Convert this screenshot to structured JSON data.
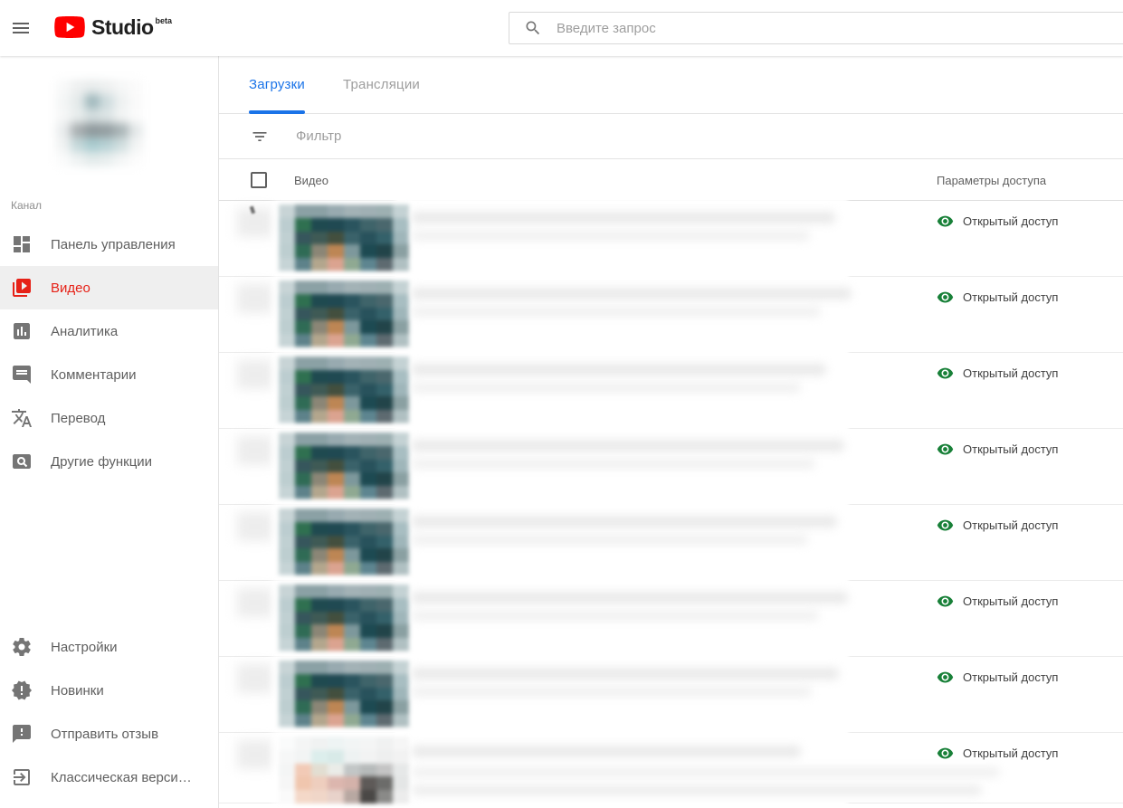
{
  "topbar": {
    "logo_text": "Studio",
    "logo_badge": "beta",
    "search_placeholder": "Введите запрос"
  },
  "sidebar": {
    "channel_label": "Канал",
    "items": [
      {
        "name": "dashboard",
        "label": "Панель управления",
        "icon": "dashboard-icon",
        "active": false
      },
      {
        "name": "videos",
        "label": "Видео",
        "icon": "video-library-icon",
        "active": true
      },
      {
        "name": "analytics",
        "label": "Аналитика",
        "icon": "analytics-icon",
        "active": false
      },
      {
        "name": "comments",
        "label": "Комментарии",
        "icon": "comments-icon",
        "active": false
      },
      {
        "name": "translations",
        "label": "Перевод",
        "icon": "translate-icon",
        "active": false
      },
      {
        "name": "other-features",
        "label": "Другие функции",
        "icon": "other-features-icon",
        "active": false
      }
    ],
    "footer_items": [
      {
        "name": "settings",
        "label": "Настройки",
        "icon": "settings-icon",
        "active": false
      },
      {
        "name": "whats-new",
        "label": "Новинки",
        "icon": "whats-new-icon",
        "active": false
      },
      {
        "name": "send-feedback",
        "label": "Отправить отзыв",
        "icon": "feedback-icon",
        "active": false
      },
      {
        "name": "classic-version",
        "label": "Классическая верси…",
        "icon": "exit-icon",
        "active": false
      }
    ]
  },
  "main": {
    "tabs": [
      {
        "name": "uploads",
        "label": "Загрузки",
        "active": true
      },
      {
        "name": "streams",
        "label": "Трансляции",
        "active": false
      }
    ],
    "filter_placeholder": "Фильтр",
    "table": {
      "columns": [
        "Видео",
        "Параметры доступа"
      ],
      "access_icon": "visibility-eye-icon",
      "rows": [
        {
          "access": "Открытый доступ",
          "thumb": "dark"
        },
        {
          "access": "Открытый доступ",
          "thumb": "dark"
        },
        {
          "access": "Открытый доступ",
          "thumb": "dark"
        },
        {
          "access": "Открытый доступ",
          "thumb": "dark"
        },
        {
          "access": "Открытый доступ",
          "thumb": "dark"
        },
        {
          "access": "Открытый доступ",
          "thumb": "dark"
        },
        {
          "access": "Открытый доступ",
          "thumb": "dark"
        },
        {
          "access": "Открытый доступ",
          "thumb": "light"
        }
      ]
    }
  },
  "colors": {
    "accent_blue": "#1a73e8",
    "brand_red": "#e62117",
    "access_green": "#188038",
    "youtube_red": "#ff0000"
  },
  "pixel_art": {
    "avatar": [
      [
        "#f8f9f9",
        "#eef0f0",
        "#e8ecec",
        "#eef0f0",
        "#f6f7f7",
        "#fbfbfb"
      ],
      [
        "#f4f6f6",
        "#e4eaea",
        "#9fb8bc",
        "#cfdcde",
        "#eef1f1",
        "#fafafa"
      ],
      [
        "#f6f7f7",
        "#e8eded",
        "#d4dedf",
        "#dde5e6",
        "#f2f4f4",
        "#fbfbfb"
      ],
      [
        "#e9eced",
        "#a8aeb0",
        "#8e989b",
        "#939da0",
        "#a9b4b6",
        "#e4e8e9"
      ],
      [
        "#f0f2f2",
        "#c4d8da",
        "#a9ccd0",
        "#b8d2d5",
        "#d0dedf",
        "#f2f4f4"
      ],
      [
        "#fafbfb",
        "#eef2f2",
        "#e2eaea",
        "#e8eeee",
        "#f4f6f6",
        "#fcfcfc"
      ]
    ],
    "thumb_dark": [
      [
        "#c8d4d6",
        "#8ba1a5",
        "#8ba1a5",
        "#98aab0",
        "#a3b2b6",
        "#a0b0b4",
        "#9db0b2",
        "#c4d2d4"
      ],
      [
        "#bccdd0",
        "#2f7050",
        "#1f4a50",
        "#204952",
        "#2a545e",
        "#3f646a",
        "#4a676d",
        "#a8bec2"
      ],
      [
        "#c0d0d2",
        "#36565c",
        "#3f5a55",
        "#434f3e",
        "#3a626a",
        "#28525c",
        "#34616a",
        "#9fb6ba"
      ],
      [
        "#bdced0",
        "#2f6b55",
        "#8b8676",
        "#bd8654",
        "#7d989c",
        "#1d4a52",
        "#224449",
        "#8aa0a2"
      ],
      [
        "#c6d4d6",
        "#5d828a",
        "#b3a68d",
        "#dba390",
        "#8fa992",
        "#5d8590",
        "#5d6a70",
        "#b0c0c2"
      ]
    ],
    "thumb_light": [
      [
        "#fafbfb",
        "#f4f5f5",
        "#f0f2f2",
        "#eef4f4",
        "#f2f5f5",
        "#f4f5f5",
        "#f0f1f1",
        "#f6f6f6"
      ],
      [
        "#f6f7f7",
        "#f2f4f4",
        "#dceeec",
        "#d8eae8",
        "#eef2f2",
        "#f2f3f3",
        "#eeefef",
        "#f2f2f2"
      ],
      [
        "#f4f5f5",
        "#f2cab6",
        "#e2ded2",
        "#eaece8",
        "#c2c6c6",
        "#b6baba",
        "#c4c4c4",
        "#e6e8e8"
      ],
      [
        "#f6f6f6",
        "#f0c6ae",
        "#eecebe",
        "#dcb6ae",
        "#d4b2aa",
        "#5e5a58",
        "#6c6c6a",
        "#e4e6e6"
      ],
      [
        "#fafafa",
        "#f4d8c8",
        "#f0d6c8",
        "#e8d2ca",
        "#b8a8a2",
        "#4a4846",
        "#8a8a88",
        "#ececec"
      ]
    ]
  }
}
